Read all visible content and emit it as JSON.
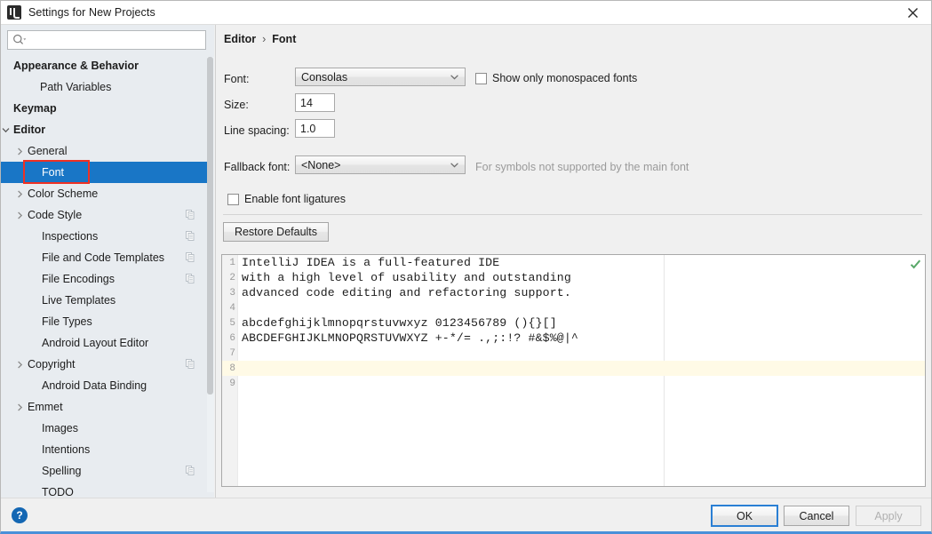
{
  "window": {
    "title": "Settings for New Projects",
    "app_icon": "intellij-logo-icon",
    "close_icon": "close-icon"
  },
  "search": {
    "value": "",
    "placeholder": "",
    "icon": "search-icon"
  },
  "sidebar": {
    "items": [
      {
        "label": "Appearance & Behavior",
        "indent": 14,
        "bold": true,
        "arrow": "none",
        "copy": false,
        "selected": false
      },
      {
        "label": "Path Variables",
        "indent": 44,
        "bold": false,
        "arrow": "none",
        "copy": false,
        "selected": false
      },
      {
        "label": "Keymap",
        "indent": 14,
        "bold": true,
        "arrow": "none",
        "copy": false,
        "selected": false
      },
      {
        "label": "Editor",
        "indent": 14,
        "bold": true,
        "arrow": "expanded",
        "copy": false,
        "selected": false
      },
      {
        "label": "General",
        "indent": 30,
        "bold": false,
        "arrow": "collapsed",
        "copy": false,
        "selected": false
      },
      {
        "label": "Font",
        "indent": 46,
        "bold": false,
        "arrow": "none",
        "copy": false,
        "selected": true
      },
      {
        "label": "Color Scheme",
        "indent": 30,
        "bold": false,
        "arrow": "collapsed",
        "copy": false,
        "selected": false
      },
      {
        "label": "Code Style",
        "indent": 30,
        "bold": false,
        "arrow": "collapsed",
        "copy": true,
        "selected": false
      },
      {
        "label": "Inspections",
        "indent": 46,
        "bold": false,
        "arrow": "none",
        "copy": true,
        "selected": false
      },
      {
        "label": "File and Code Templates",
        "indent": 46,
        "bold": false,
        "arrow": "none",
        "copy": true,
        "selected": false
      },
      {
        "label": "File Encodings",
        "indent": 46,
        "bold": false,
        "arrow": "none",
        "copy": true,
        "selected": false
      },
      {
        "label": "Live Templates",
        "indent": 46,
        "bold": false,
        "arrow": "none",
        "copy": false,
        "selected": false
      },
      {
        "label": "File Types",
        "indent": 46,
        "bold": false,
        "arrow": "none",
        "copy": false,
        "selected": false
      },
      {
        "label": "Android Layout Editor",
        "indent": 46,
        "bold": false,
        "arrow": "none",
        "copy": false,
        "selected": false
      },
      {
        "label": "Copyright",
        "indent": 30,
        "bold": false,
        "arrow": "collapsed",
        "copy": true,
        "selected": false
      },
      {
        "label": "Android Data Binding",
        "indent": 46,
        "bold": false,
        "arrow": "none",
        "copy": false,
        "selected": false
      },
      {
        "label": "Emmet",
        "indent": 30,
        "bold": false,
        "arrow": "collapsed",
        "copy": false,
        "selected": false
      },
      {
        "label": "Images",
        "indent": 46,
        "bold": false,
        "arrow": "none",
        "copy": false,
        "selected": false
      },
      {
        "label": "Intentions",
        "indent": 46,
        "bold": false,
        "arrow": "none",
        "copy": false,
        "selected": false
      },
      {
        "label": "Spelling",
        "indent": 46,
        "bold": false,
        "arrow": "none",
        "copy": true,
        "selected": false
      },
      {
        "label": "TODO",
        "indent": 46,
        "bold": false,
        "arrow": "none",
        "copy": false,
        "selected": false
      }
    ],
    "selection_color": "#1976c6",
    "annotation_box_color": "#ef3124"
  },
  "breadcrumb": {
    "root": "Editor",
    "separator": "›",
    "leaf": "Font"
  },
  "form": {
    "font_label": "Font:",
    "font_value": "Consolas",
    "size_label": "Size:",
    "size_value": "14",
    "line_spacing_label": "Line spacing:",
    "line_spacing_value": "1.0",
    "fallback_label": "Fallback font:",
    "fallback_value": "<None>",
    "fallback_hint": "For symbols not supported by the main font",
    "monospaced_checkbox_label": "Show only monospaced fonts",
    "monospaced_checked": false,
    "ligatures_checkbox_label": "Enable font ligatures",
    "ligatures_checked": false,
    "restore_defaults_label": "Restore Defaults"
  },
  "preview": {
    "lines": [
      {
        "n": "1",
        "text": "IntelliJ IDEA is a full-featured IDE",
        "caret": false
      },
      {
        "n": "2",
        "text": "with a high level of usability and outstanding",
        "caret": false
      },
      {
        "n": "3",
        "text": "advanced code editing and refactoring support.",
        "caret": false
      },
      {
        "n": "4",
        "text": "",
        "caret": false
      },
      {
        "n": "5",
        "text": "abcdefghijklmnopqrstuvwxyz 0123456789 (){}[]",
        "caret": false
      },
      {
        "n": "6",
        "text": "ABCDEFGHIJKLMNOPQRSTUVWXYZ +-*/= .,;:!? #&$%@|^",
        "caret": false
      },
      {
        "n": "7",
        "text": "",
        "caret": false
      },
      {
        "n": "8",
        "text": "",
        "caret": true
      },
      {
        "n": "9",
        "text": "",
        "caret": false
      }
    ],
    "inspection_icon": "green-checkmark-icon",
    "inspection_color": "#59a869",
    "caret_line_color": "#fffae6"
  },
  "footer": {
    "help_label": "?",
    "ok_label": "OK",
    "cancel_label": "Cancel",
    "apply_label": "Apply",
    "apply_disabled": true,
    "focus_color": "#2a7fd4"
  }
}
